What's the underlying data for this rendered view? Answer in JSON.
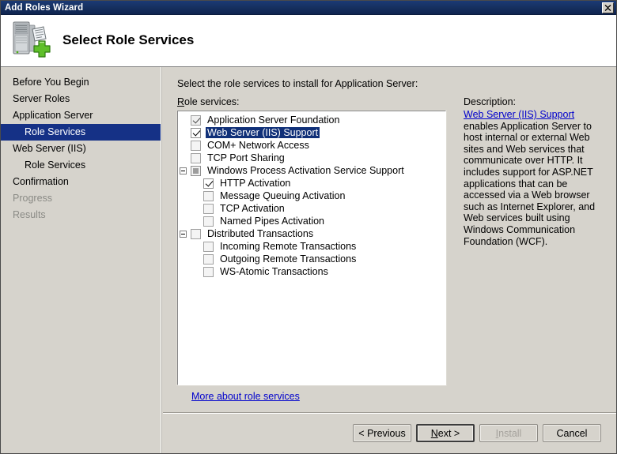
{
  "window": {
    "title": "Add Roles Wizard",
    "close_label": "Close"
  },
  "header": {
    "title": "Select Role Services",
    "icon": "server-add-icon"
  },
  "sidebar": {
    "items": [
      {
        "label": "Before You Begin",
        "level": 0,
        "state": "normal"
      },
      {
        "label": "Server Roles",
        "level": 0,
        "state": "normal"
      },
      {
        "label": "Application Server",
        "level": 0,
        "state": "normal"
      },
      {
        "label": "Role Services",
        "level": 1,
        "state": "selected"
      },
      {
        "label": "Web Server (IIS)",
        "level": 0,
        "state": "normal"
      },
      {
        "label": "Role Services",
        "level": 1,
        "state": "normal"
      },
      {
        "label": "Confirmation",
        "level": 0,
        "state": "normal"
      },
      {
        "label": "Progress",
        "level": 0,
        "state": "disabled"
      },
      {
        "label": "Results",
        "level": 0,
        "state": "disabled"
      }
    ]
  },
  "content": {
    "intro": "Select the role services to install for Application Server:",
    "tree_label_prefix": "R",
    "tree_label_rest": "ole services:",
    "more_link": "More about role services"
  },
  "tree": {
    "items": [
      {
        "label": "Application Server Foundation",
        "checkbox": "checked-disabled",
        "expander": "none",
        "indent": 0,
        "selected": false
      },
      {
        "label": "Web Server (IIS) Support",
        "checkbox": "checked",
        "expander": "none",
        "indent": 0,
        "selected": true
      },
      {
        "label": "COM+ Network Access",
        "checkbox": "empty",
        "expander": "none",
        "indent": 0,
        "selected": false
      },
      {
        "label": "TCP Port Sharing",
        "checkbox": "empty",
        "expander": "none",
        "indent": 0,
        "selected": false
      },
      {
        "label": "Windows Process Activation Service Support",
        "checkbox": "indeterminate",
        "expander": "collapse",
        "indent": 0,
        "selected": false
      },
      {
        "label": "HTTP Activation",
        "checkbox": "checked",
        "expander": "none",
        "indent": 1,
        "selected": false
      },
      {
        "label": "Message Queuing Activation",
        "checkbox": "empty",
        "expander": "none",
        "indent": 1,
        "selected": false
      },
      {
        "label": "TCP Activation",
        "checkbox": "empty",
        "expander": "none",
        "indent": 1,
        "selected": false
      },
      {
        "label": "Named Pipes Activation",
        "checkbox": "empty",
        "expander": "none",
        "indent": 1,
        "selected": false
      },
      {
        "label": "Distributed Transactions",
        "checkbox": "empty",
        "expander": "collapse",
        "indent": 0,
        "selected": false
      },
      {
        "label": "Incoming Remote Transactions",
        "checkbox": "empty",
        "expander": "none",
        "indent": 1,
        "selected": false
      },
      {
        "label": "Outgoing Remote Transactions",
        "checkbox": "empty",
        "expander": "none",
        "indent": 1,
        "selected": false
      },
      {
        "label": "WS-Atomic Transactions",
        "checkbox": "empty",
        "expander": "none",
        "indent": 1,
        "selected": false
      }
    ]
  },
  "description": {
    "heading": "Description:",
    "link": "Web Server (IIS) Support",
    "body": " enables Application Server to host internal or external Web sites and Web services that communicate over HTTP. It includes support for ASP.NET applications that can be accessed via a Web browser such as Internet Explorer, and Web services built using Windows Communication Foundation (WCF)."
  },
  "footer": {
    "previous": "< Previous",
    "next_prefix": "N",
    "next_accel": "",
    "next_rest": "ext >",
    "install_prefix": "I",
    "install_rest": "nstall",
    "cancel": "Cancel"
  },
  "colors": {
    "titlebar": "#16305f",
    "selection": "#153186",
    "link": "#0000cc",
    "dialog_face": "#d6d3cc",
    "accent_green": "#5ab52b"
  }
}
